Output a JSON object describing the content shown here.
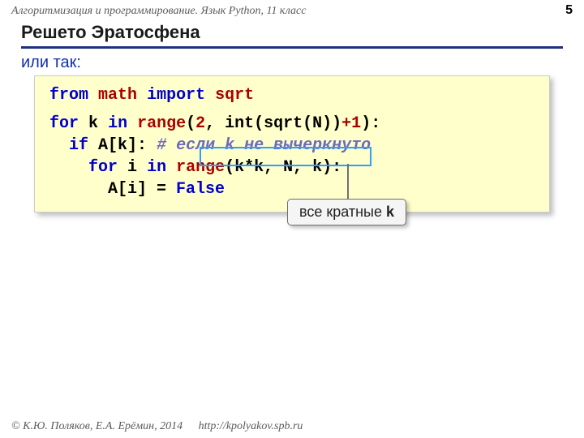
{
  "header": {
    "course": "Алгоритмизация и программирование. Язык Python, 11 класс",
    "page": "5"
  },
  "title": "Решето Эратосфена",
  "subtitle": "или так:",
  "code": {
    "l1_from": "from",
    "l1_math": "math",
    "l1_import": "import",
    "l1_sqrt": "sqrt",
    "l2_for": "for",
    "l2_k": "k",
    "l2_in": "in",
    "l2_range": "range",
    "l2_open": "(",
    "l2_two": "2",
    "l2_after2": ", int(sqrt(N))",
    "l2_plus1": "+1",
    "l2_close": "):",
    "l3_if": "if",
    "l3_cond": "A[k]:",
    "l3_comment": "# если k не вычеркнуто",
    "l4_for": "for",
    "l4_i": "i",
    "l4_in": "in",
    "l4_range": "range",
    "l4_args_open": "(",
    "l4_args": "k*k, N, k)",
    "l4_colon": ":",
    "l5_lhs": "A[i] =",
    "l5_false": "False"
  },
  "callout": {
    "text_prefix": "все кратные ",
    "text_bold": "k"
  },
  "footer": {
    "copyright": "© К.Ю. Поляков, Е.А. Ерёмин, 2014",
    "url": "http://kpolyakov.spb.ru"
  }
}
